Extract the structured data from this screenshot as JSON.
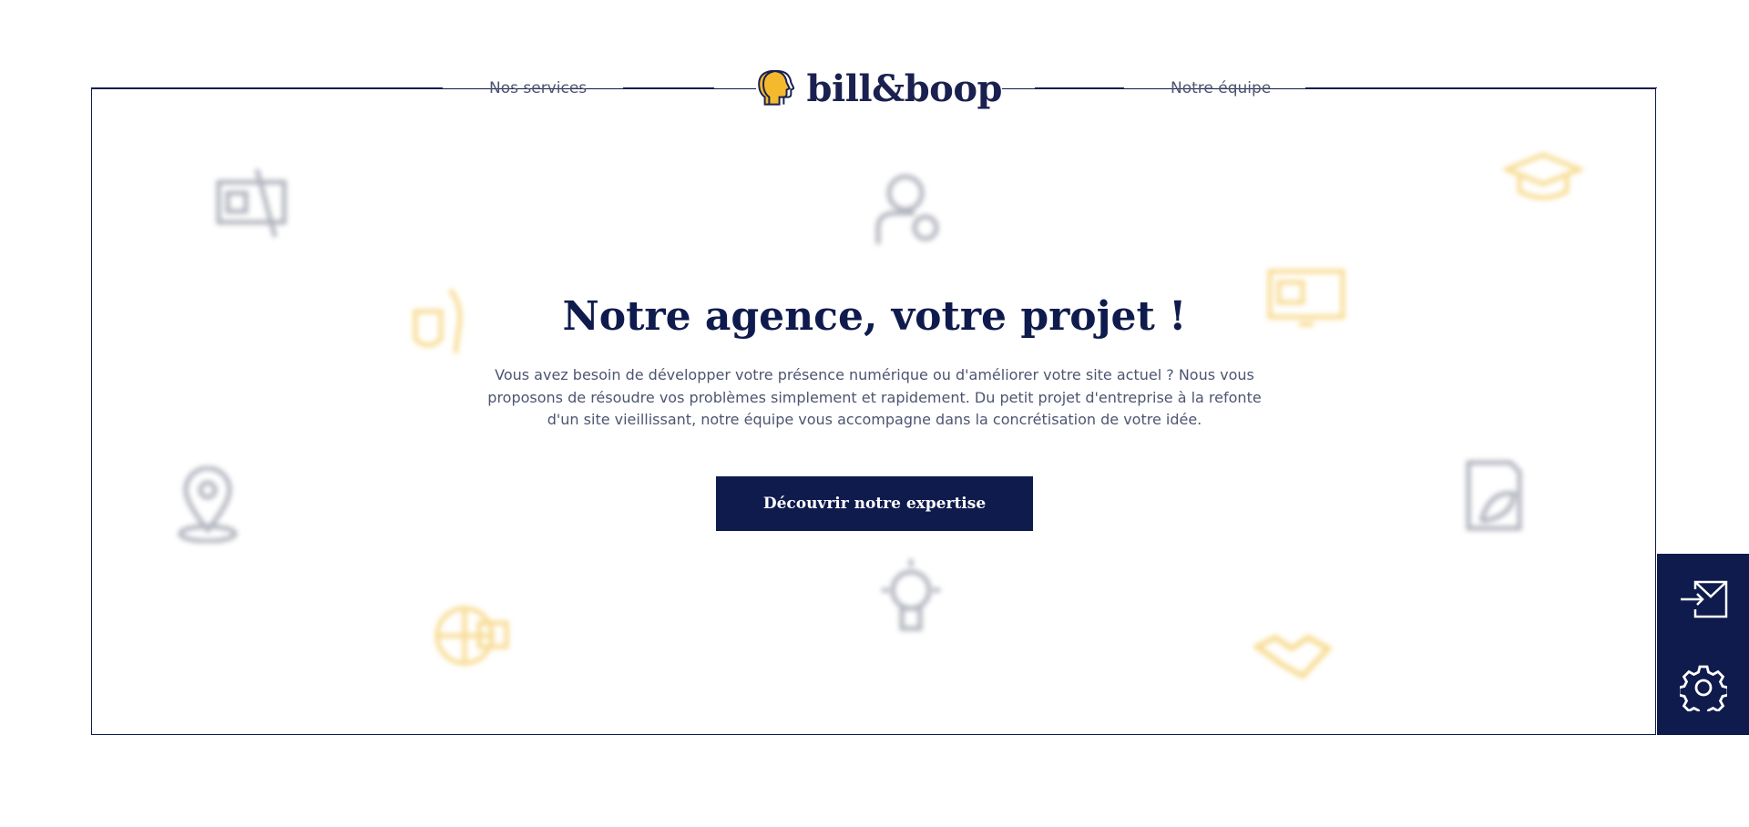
{
  "header": {
    "nav_left": "Nos services",
    "nav_right": "Notre équipe",
    "logo_text": "bill&boop"
  },
  "hero": {
    "title": "Notre agence, votre projet !",
    "description": "Vous avez besoin de développer votre présence numérique ou d'améliorer votre site actuel ? Nous vous proposons de résoudre vos problèmes simplement et rapidement. Du petit projet d'entreprise à la refonte d'un site vieillissant, notre équipe vous accompagne dans la concrétisation de votre idée.",
    "cta_label": "Découvrir notre expertise"
  },
  "side_panel": {
    "icons": [
      "mail-send-icon",
      "gear-icon"
    ]
  },
  "background_icons": [
    "blueprint-icon",
    "user-settings-icon",
    "graduation-cap-icon",
    "brush-icon",
    "monitor-icon",
    "map-pin-icon",
    "document-leaf-icon",
    "lightbulb-icon",
    "globe-monitor-icon",
    "handshake-icon"
  ],
  "colors": {
    "navy": "#0f1b4d",
    "accent_yellow": "#f5b92e",
    "muted_gray": "#a9acb8",
    "text_gray": "#4d5570"
  }
}
